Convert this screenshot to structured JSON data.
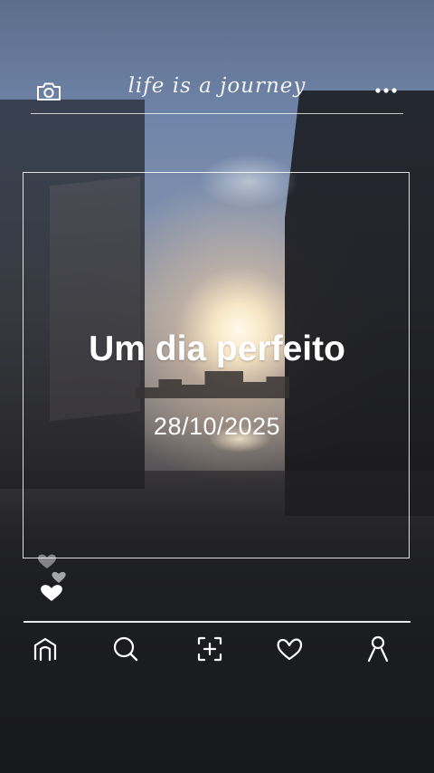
{
  "header": {
    "title": "life is a journey",
    "left_icon": "camera-icon",
    "right_icon": "more-options-icon"
  },
  "post": {
    "headline": "Um dia perfeito",
    "date": "28/10/2025"
  },
  "reactions": {
    "icon": "hearts-icon"
  },
  "nav": {
    "items": [
      {
        "icon": "home-icon"
      },
      {
        "icon": "search-icon"
      },
      {
        "icon": "add-post-icon"
      },
      {
        "icon": "heart-icon"
      },
      {
        "icon": "profile-icon"
      }
    ]
  },
  "colors": {
    "foreground": "#ffffff",
    "background_dark": "#1a1b1e"
  }
}
